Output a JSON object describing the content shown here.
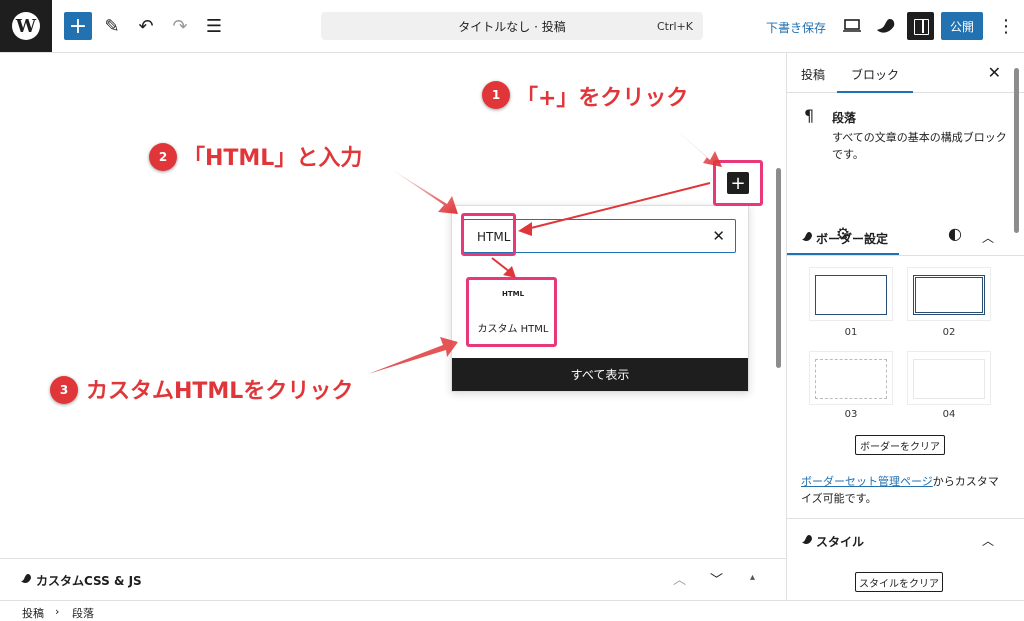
{
  "toolbar": {
    "logo": "W",
    "add_label": "+",
    "pen_icon": "✎",
    "undo_icon": "↶",
    "redo_icon": "↷",
    "list_icon": "☰",
    "doc_title": "タイトルなし · 投稿",
    "shortcut": "Ctrl+K",
    "save_draft": "下書き保存",
    "publish": "公開",
    "more_icon": "⋮"
  },
  "inserter": {
    "search_value": "HTML",
    "clear_icon": "✕",
    "result_icon_text": "HTML",
    "result_label": "カスタム HTML",
    "show_all": "すべて表示",
    "plus_icon": "+"
  },
  "annotations": {
    "step1_num": "1",
    "step1_text": "「+」をクリック",
    "step2_num": "2",
    "step2_text": "「HTML」と入力",
    "step3_num": "3",
    "step3_text": "カスタムHTMLをクリック"
  },
  "meta_panel": {
    "title": "カスタムCSS & JS",
    "up": "︿",
    "down": "﹀",
    "tri": "▴"
  },
  "breadcrumb": {
    "items": [
      "投稿",
      "段落"
    ],
    "sep": "›"
  },
  "sidebar": {
    "tab_post": "投稿",
    "tab_block": "ブロック",
    "close_icon": "✕",
    "block_icon": "¶",
    "block_name": "段落",
    "block_desc": "すべての文章の基本の構成ブロックです。",
    "gear_icon": "⚙",
    "style_icon": "◐",
    "border_panel_title": "ボーダー設定",
    "chevron_up": "︿",
    "options": [
      "01",
      "02",
      "03",
      "04"
    ],
    "clear_border": "ボーダーをクリア",
    "note_link": "ボーダーセット管理ページ",
    "note_text": "からカスタマイズ可能です。",
    "style_panel_title": "スタイル",
    "clear_style": "スタイルをクリア"
  },
  "colors": {
    "accent": "#2271b1",
    "annotation": "#e0363a",
    "highlight": "#e8387a",
    "dark": "#1e1e1e"
  }
}
